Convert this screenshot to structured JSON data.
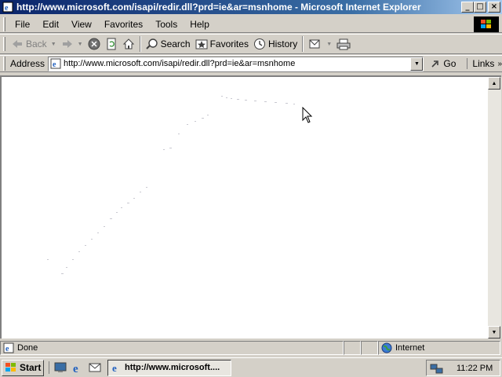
{
  "window": {
    "title": "http://www.microsoft.com/isapi/redir.dll?prd=ie&ar=msnhome - Microsoft Internet Explorer",
    "buttons": {
      "minimize": "_",
      "maximize": "□",
      "close": "×"
    }
  },
  "menu": [
    "File",
    "Edit",
    "View",
    "Favorites",
    "Tools",
    "Help"
  ],
  "toolbar": {
    "back": "Back",
    "search": "Search",
    "favorites": "Favorites",
    "history": "History"
  },
  "address": {
    "label": "Address",
    "url": "http://www.microsoft.com/isapi/redir.dll?prd=ie&ar=msnhome",
    "go": "Go",
    "links": "Links"
  },
  "status": {
    "text": "Done",
    "zone": "Internet"
  },
  "taskbar": {
    "start": "Start",
    "task": "http://www.microsoft....",
    "clock": "11:22 PM"
  },
  "icons": [
    "ie-page-icon",
    "back-arrow-icon",
    "forward-arrow-icon",
    "stop-icon",
    "refresh-icon",
    "home-icon",
    "search-icon",
    "favorites-icon",
    "history-icon",
    "mail-icon",
    "print-icon",
    "go-icon",
    "globe-icon",
    "windows-logo-icon",
    "desktop-icon",
    "outlook-icon",
    "channels-icon",
    "network-icon",
    "cursor-icon"
  ]
}
